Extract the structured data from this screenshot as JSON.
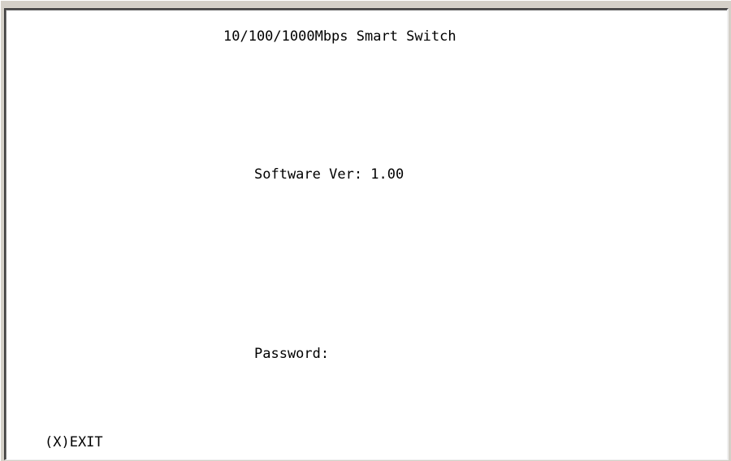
{
  "terminal": {
    "title": "10/100/1000Mbps Smart Switch",
    "software_version": "Software Ver: 1.00",
    "password_label": "Password:",
    "password_value": "",
    "exit_label": "(X)EXIT"
  },
  "colors": {
    "window_chrome": "#d4d0c8",
    "screen_background": "#ffffff",
    "text": "#000000"
  }
}
